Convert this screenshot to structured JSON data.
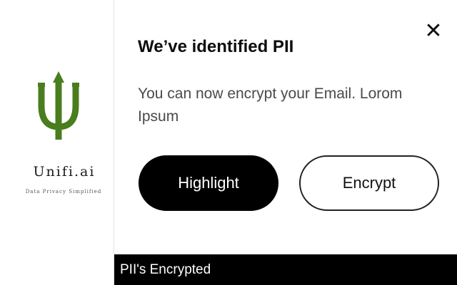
{
  "brand": {
    "name": "Unifi.ai",
    "tagline": "Data Privacy Simplified",
    "logo_icon": "trident-u-logo",
    "logo_color": "#4a7d1e"
  },
  "dialog": {
    "title": "We’ve identified PII",
    "message": "You can now encrypt your Email. Lorom Ipsum",
    "close_icon": "close-icon",
    "close_glyph": "✕",
    "highlight_label": "Highlight",
    "encrypt_label": "Encrypt"
  },
  "status": {
    "text": "PII's Encrypted"
  },
  "colors": {
    "primary": "#000000",
    "accent": "#4a7d1e",
    "background": "#ffffff"
  }
}
